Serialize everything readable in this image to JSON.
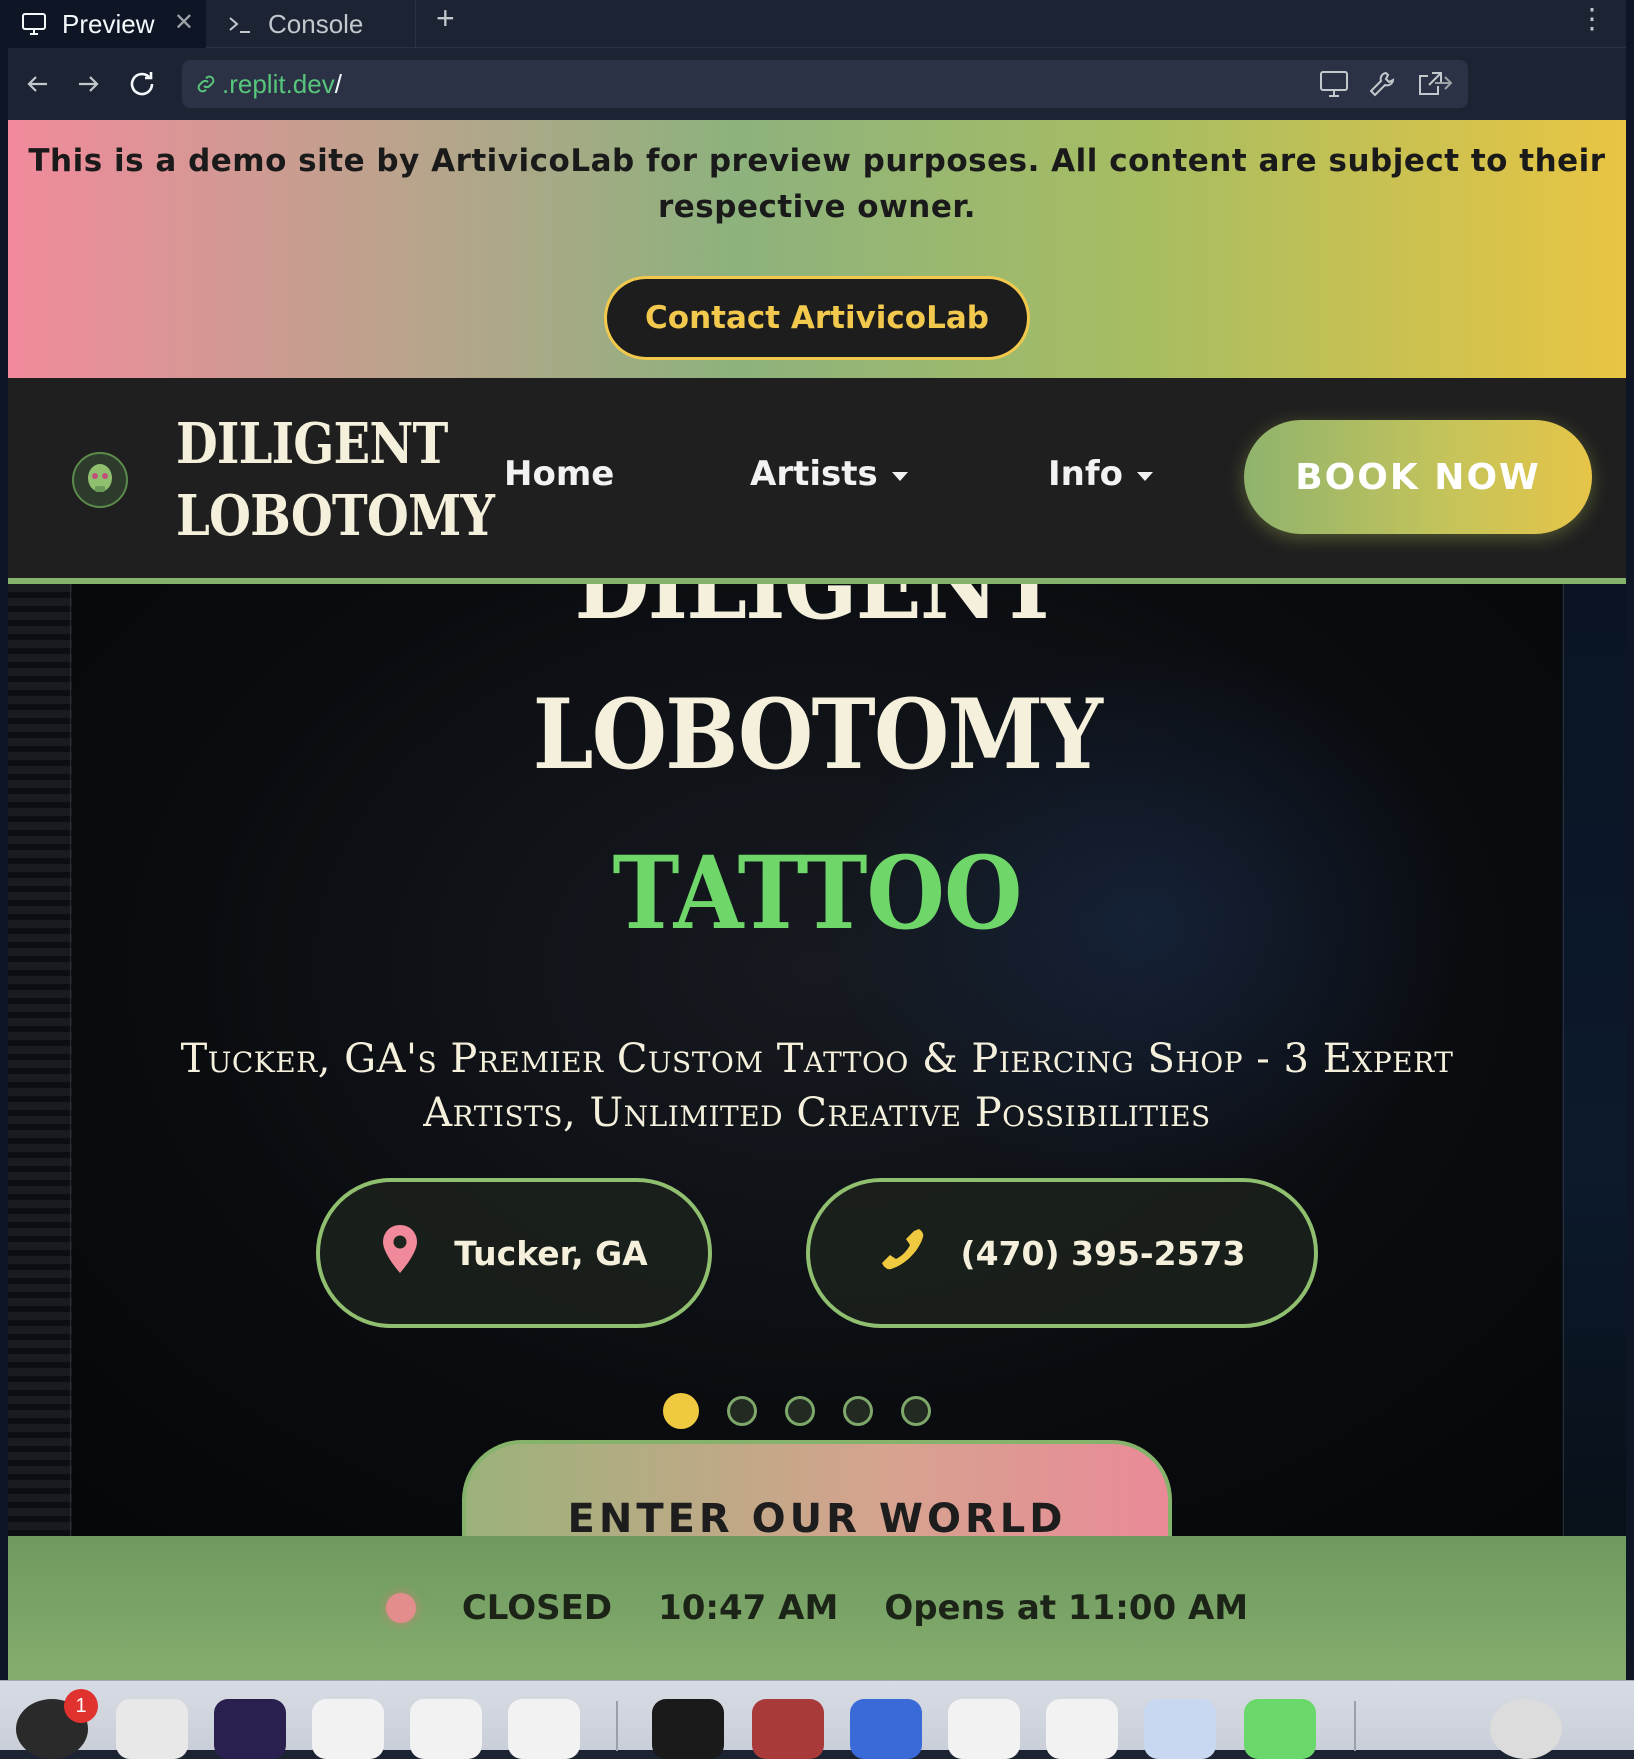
{
  "browser": {
    "tabs": [
      {
        "label": "Preview",
        "icon": "monitor-icon",
        "active": true
      },
      {
        "label": "Console",
        "icon": "terminal-prompt-icon",
        "active": false
      }
    ],
    "url_host": ".replit.dev",
    "url_path": "/"
  },
  "demo_banner": {
    "text": "This is a demo site by ArtivicoLab for preview purposes. All content are subject to their respective owner.",
    "button_label": "Contact ArtivicoLab"
  },
  "nav": {
    "logo_line1": "DILIGENT",
    "logo_line2": "LOBOTOMY",
    "links": [
      {
        "label": "Home",
        "dropdown": false
      },
      {
        "label": "Artists",
        "dropdown": true
      },
      {
        "label": "Info",
        "dropdown": true
      }
    ],
    "cta_label": "BOOK NOW"
  },
  "hero": {
    "title_line1": "DILIGENT",
    "title_line2": "LOBOTOMY",
    "title_line3": "TATTOO",
    "tagline": "Tucker, GA's Premier Custom Tattoo & Piercing Shop - 3 Expert Artists, Unlimited Creative Possibilities",
    "location_label": "Tucker, GA",
    "phone_label": "(470) 395-2573",
    "slides_total": 5,
    "slide_active": 1,
    "enter_label": "ENTER OUR WORLD"
  },
  "status": {
    "state": "CLOSED",
    "time": "10:47 AM",
    "next": "Opens at 11:00 AM"
  },
  "dock": {
    "badge_count": "1"
  },
  "colors": {
    "accent_green": "#86b36b",
    "accent_yellow": "#efc93f",
    "accent_pink": "#ea8a98",
    "nav_bg": "#1f1f1f",
    "tattoo_green": "#6fd66a"
  }
}
